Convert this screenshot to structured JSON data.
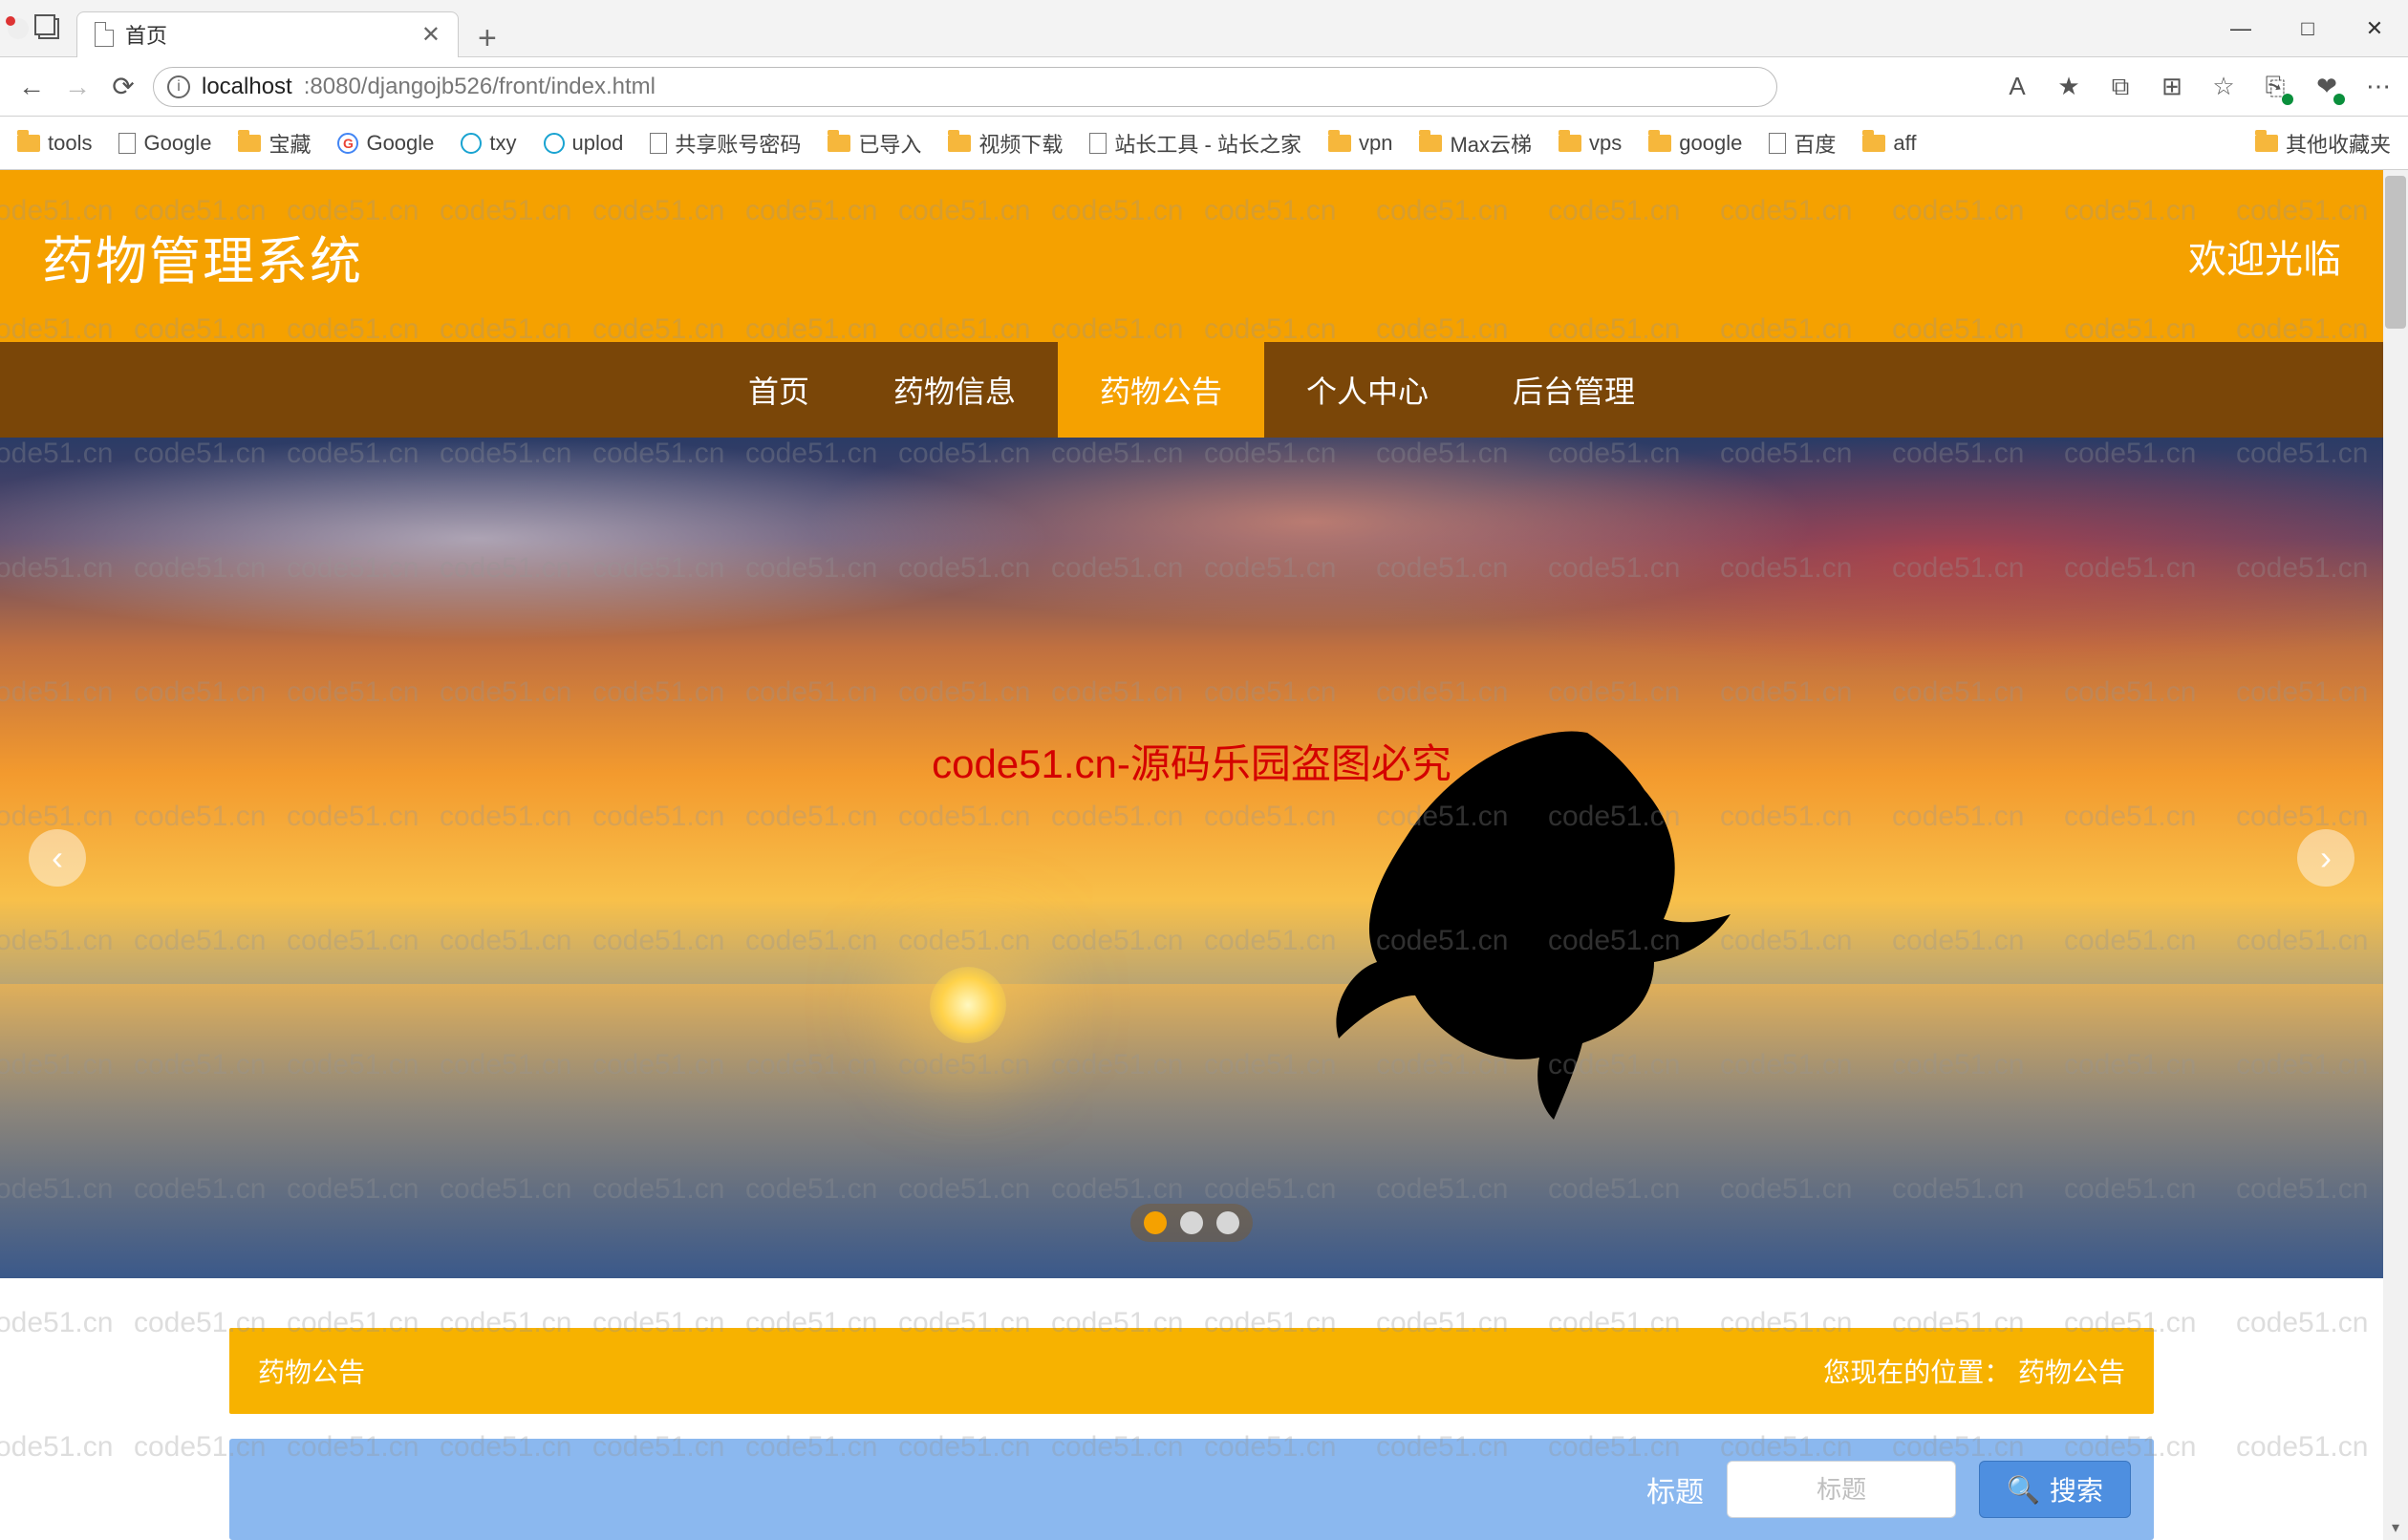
{
  "browser": {
    "tab_title": "首页",
    "new_tab_tooltip": "+",
    "win_min": "—",
    "win_max": "□",
    "win_close": "✕",
    "nav": {
      "back": "←",
      "forward": "→",
      "refresh": "⟳"
    },
    "address": {
      "host": "localhost",
      "port_path": ":8080/djangojb526/front/index.html"
    },
    "toolbar_icons": [
      "A",
      "★",
      "⧉",
      "⊞",
      "☆",
      "⎘",
      "❤",
      "⋯"
    ]
  },
  "bookmarks": [
    {
      "label": "tools",
      "icon": "folder"
    },
    {
      "label": "Google",
      "icon": "page"
    },
    {
      "label": "宝藏",
      "icon": "folder"
    },
    {
      "label": "Google",
      "icon": "google"
    },
    {
      "label": "txy",
      "icon": "globe"
    },
    {
      "label": "uplod",
      "icon": "globe"
    },
    {
      "label": "共享账号密码",
      "icon": "page"
    },
    {
      "label": "已导入",
      "icon": "folder"
    },
    {
      "label": "视频下载",
      "icon": "folder"
    },
    {
      "label": "站长工具 - 站长之家",
      "icon": "page"
    },
    {
      "label": "vpn",
      "icon": "folder"
    },
    {
      "label": "Max云梯",
      "icon": "folder"
    },
    {
      "label": "vps",
      "icon": "folder"
    },
    {
      "label": "google",
      "icon": "folder"
    },
    {
      "label": "百度",
      "icon": "page"
    },
    {
      "label": "aff",
      "icon": "folder"
    }
  ],
  "bookmarks_overflow": "其他收藏夹",
  "site": {
    "title": "药物管理系统",
    "welcome": "欢迎光临"
  },
  "nav": {
    "items": [
      "首页",
      "药物信息",
      "药物公告",
      "个人中心",
      "后台管理"
    ],
    "active_index": 2
  },
  "carousel": {
    "overlay_text": "code51.cn-源码乐园盗图必究",
    "prev": "‹",
    "next": "›",
    "dots_count": 3,
    "active_dot": 0
  },
  "section": {
    "title": "药物公告",
    "breadcrumb_label": "您现在的位置：",
    "breadcrumb_current": "药物公告"
  },
  "search": {
    "field_label": "标题",
    "placeholder": "标题",
    "button_label": "搜索",
    "search_icon": "🔍"
  },
  "watermark_text": "code51.cn"
}
